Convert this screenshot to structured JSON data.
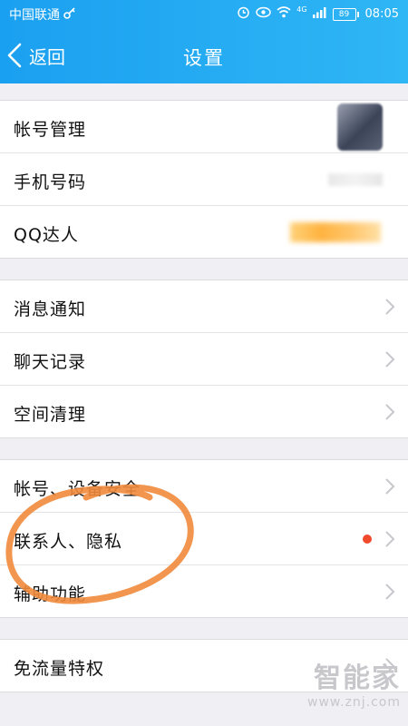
{
  "status_bar": {
    "carrier": "中国联通",
    "signal_label": "4G",
    "battery": "89",
    "time": "08:05"
  },
  "nav": {
    "back_label": "返回",
    "title": "设置"
  },
  "groups": [
    {
      "items": [
        {
          "label": "帐号管理"
        },
        {
          "label": "手机号码"
        },
        {
          "label": "QQ达人"
        }
      ]
    },
    {
      "items": [
        {
          "label": "消息通知"
        },
        {
          "label": "聊天记录"
        },
        {
          "label": "空间清理"
        }
      ]
    },
    {
      "items": [
        {
          "label": "帐号、设备安全"
        },
        {
          "label": "联系人、隐私"
        },
        {
          "label": "辅助功能"
        }
      ]
    },
    {
      "items": [
        {
          "label": "免流量特权"
        }
      ]
    }
  ],
  "colors": {
    "header": "#1aa0f0",
    "badge": "#f04a2c",
    "annotation": "#f08a3c"
  },
  "watermark": {
    "brand": "智能家",
    "url": "www.znj.com"
  }
}
